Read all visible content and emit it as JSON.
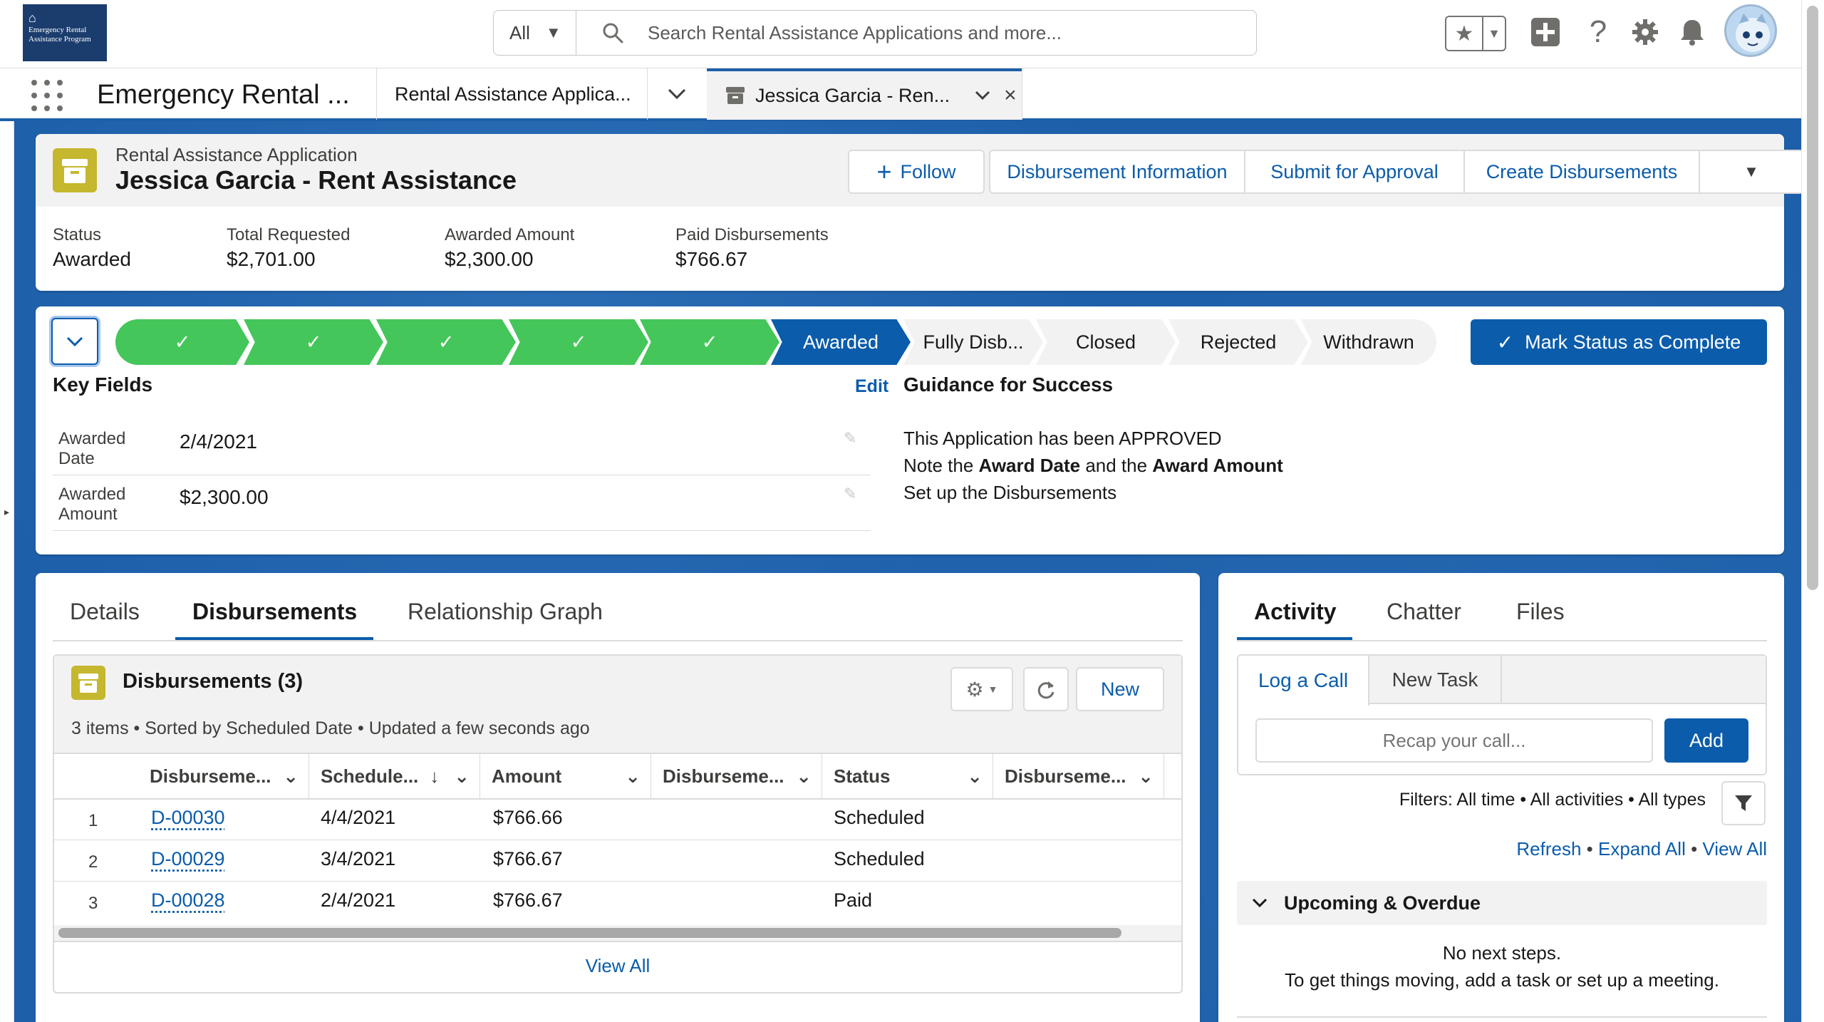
{
  "logo": {
    "text": "Emergency Rental Assistance Program"
  },
  "search": {
    "scope": "All",
    "placeholder": "Search Rental Assistance Applications and more..."
  },
  "header_icons": [
    "star-icon",
    "add-icon",
    "help-icon",
    "setup-gear-icon",
    "notification-bell-icon",
    "user-avatar"
  ],
  "nav": {
    "app_name": "Emergency Rental ...",
    "tabs": [
      {
        "label": "Rental Assistance Applica..."
      },
      {
        "label": "Jessica Garcia - Ren..."
      }
    ]
  },
  "record": {
    "object_label": "Rental Assistance Application",
    "title": "Jessica Garcia - Rent Assistance",
    "actions": {
      "follow": "Follow",
      "disbursement_info": "Disbursement Information",
      "submit": "Submit for Approval",
      "create": "Create Disbursements"
    },
    "highlights": [
      {
        "label": "Status",
        "value": "Awarded"
      },
      {
        "label": "Total Requested",
        "value": "$2,701.00"
      },
      {
        "label": "Awarded Amount",
        "value": "$2,300.00"
      },
      {
        "label": "Paid Disbursements",
        "value": "$766.67"
      }
    ]
  },
  "path": {
    "completed_steps": 5,
    "current": "Awarded",
    "upcoming": [
      "Fully Disb...",
      "Closed",
      "Rejected",
      "Withdrawn"
    ],
    "mark_complete": "Mark Status as Complete"
  },
  "key_fields": {
    "title": "Key Fields",
    "edit": "Edit",
    "fields": [
      {
        "label_1": "Awarded",
        "label_2": "Date",
        "value": "2/4/2021"
      },
      {
        "label_1": "Awarded",
        "label_2": "Amount",
        "value": "$2,300.00"
      }
    ]
  },
  "guidance": {
    "title": "Guidance for Success",
    "line1": "This Application has been APPROVED",
    "line2_a": "Note the ",
    "line2_b": "Award Date",
    "line2_c": " and the ",
    "line2_d": "Award Amount",
    "line3": "Set up the Disbursements"
  },
  "detail_tabs": [
    "Details",
    "Disbursements",
    "Relationship Graph"
  ],
  "disbursements": {
    "title": "Disbursements (3)",
    "new": "New",
    "meta": "3 items • Sorted by Scheduled Date • Updated a few seconds ago",
    "columns": [
      "Disburseme...",
      "Schedule...",
      "Amount",
      "Disburseme...",
      "Status",
      "Disburseme..."
    ],
    "rows": [
      {
        "num": "1",
        "id": "D-00030",
        "date": "4/4/2021",
        "amount": "$766.66",
        "status": "Scheduled"
      },
      {
        "num": "2",
        "id": "D-00029",
        "date": "3/4/2021",
        "amount": "$766.67",
        "status": "Scheduled"
      },
      {
        "num": "3",
        "id": "D-00028",
        "date": "2/4/2021",
        "amount": "$766.67",
        "status": "Paid"
      }
    ],
    "view_all": "View All"
  },
  "activity": {
    "tabs": [
      "Activity",
      "Chatter",
      "Files"
    ],
    "subtabs": [
      "Log a Call",
      "New Task"
    ],
    "recap_placeholder": "Recap your call...",
    "add": "Add",
    "filters": "Filters: All time • All activities • All types",
    "links": [
      "Refresh",
      "Expand All",
      "View All"
    ],
    "upcoming_title": "Upcoming & Overdue",
    "empty_1": "No next steps.",
    "empty_2": "To get things moving, add a task or set up a meeting."
  },
  "colors": {
    "brand": "#0b5cab",
    "path_complete": "#45c65a",
    "header_blue": "#1d5fa9",
    "record_icon": "#c5b72e"
  }
}
